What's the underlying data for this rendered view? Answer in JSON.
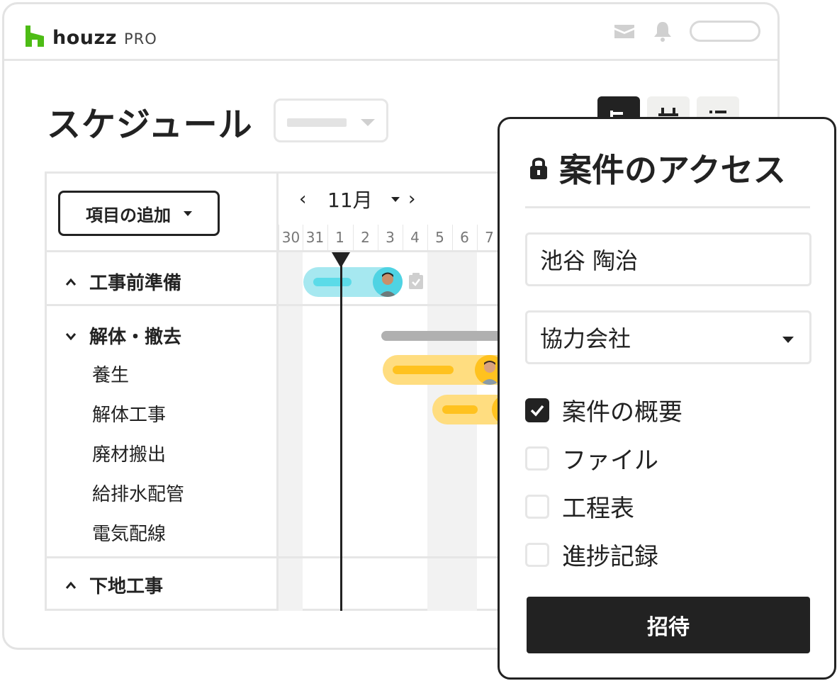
{
  "brand": {
    "name": "houzz",
    "suffix": "PRO",
    "color": "#4dbc15"
  },
  "page": {
    "title": "スケジュール"
  },
  "toolbar": {
    "add_item_label": "項目の追加"
  },
  "calendar": {
    "month": "11月",
    "prev": "‹",
    "next": "›",
    "days": [
      "30",
      "31",
      "1",
      "2",
      "3",
      "4",
      "5",
      "6",
      "7"
    ],
    "today": "1"
  },
  "groups": [
    {
      "label": "工事前準備",
      "state": "collapsed"
    },
    {
      "label": "解体・撤去",
      "state": "expanded",
      "tasks": [
        "養生",
        "解体工事",
        "廃材搬出",
        "給排水配管",
        "電気配線"
      ]
    },
    {
      "label": "下地工事",
      "state": "collapsed"
    }
  ],
  "bar_colors": {
    "teal": "#a6e8f0",
    "teal_inner": "#5bdbe8",
    "yellow": "#ffdd80",
    "yellow_inner": "#ffc21f",
    "grey": "#b0b0b0"
  },
  "icons": [
    "mail-icon",
    "bell-icon",
    "lock-icon",
    "chevron-up-icon",
    "chevron-down-icon",
    "checkmark-icon",
    "clipboard-icon"
  ],
  "access_panel": {
    "title": "案件のアクセス",
    "name_value": "池谷 陶治",
    "role_value": "協力会社",
    "permissions": [
      {
        "label": "案件の概要",
        "checked": true
      },
      {
        "label": "ファイル",
        "checked": false
      },
      {
        "label": "工程表",
        "checked": false
      },
      {
        "label": "進捗記録",
        "checked": false
      }
    ],
    "invite_label": "招待"
  }
}
